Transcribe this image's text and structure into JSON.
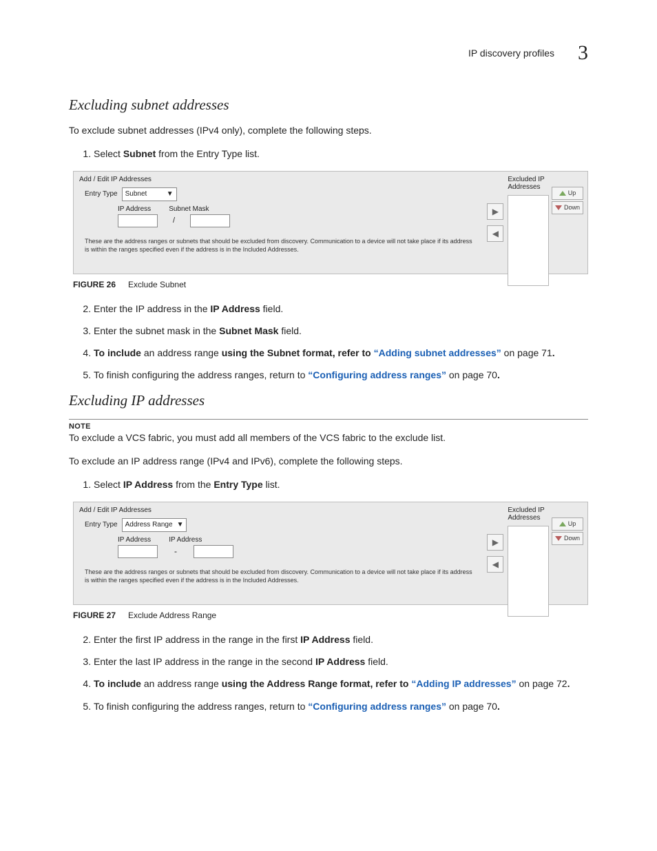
{
  "header": {
    "title": "IP discovery profiles",
    "chapter": "3"
  },
  "sec1": {
    "heading": "Excluding subnet addresses",
    "intro": "To exclude subnet addresses (IPv4 only), complete the following steps.",
    "step1_a": "Select ",
    "step1_b": "Subnet",
    "step1_c": " from the Entry Type list.",
    "fig": {
      "num": "FIGURE 26",
      "caption": "Exclude Subnet"
    },
    "step2_a": "Enter the IP address in the ",
    "step2_b": "IP Address",
    "step2_c": " field.",
    "step3_a": "Enter the subnet mask in the ",
    "step3_b": "Subnet Mask",
    "step3_c": " field.",
    "step4_a": "To include ",
    "step4_b": "an address range ",
    "step4_c": "using the Subnet format, refer to ",
    "step4_link": "“Adding subnet addresses”",
    "step4_d": " on page 71",
    "step4_e": ".",
    "step5_a": "To finish configuring the address ranges, return to ",
    "step5_link": "“Configuring address ranges”",
    "step5_b": " on page 70",
    "step5_c": "."
  },
  "sec2": {
    "heading": "Excluding IP addresses",
    "note_label": "NOTE",
    "note_text": "To exclude a VCS fabric, you must add all members of the VCS fabric to the exclude list.",
    "intro": "To exclude an IP address range (IPv4 and IPv6), complete the following steps.",
    "step1_a": "Select ",
    "step1_b": "IP Address",
    "step1_c": " from the ",
    "step1_d": "Entry Type",
    "step1_e": " list.",
    "fig": {
      "num": "FIGURE 27",
      "caption": "Exclude Address Range"
    },
    "step2_a": "Enter the first IP address in the range in the first ",
    "step2_b": "IP Address",
    "step2_c": " field.",
    "step3_a": "Enter the last IP address in the range in the second ",
    "step3_b": "IP Address",
    "step3_c": " field.",
    "step4_a": "To include ",
    "step4_b": "an address range ",
    "step4_c": "using the Address Range format, refer to ",
    "step4_link": "“Adding IP addresses”",
    "step4_d": " on page 72",
    "step4_e": ".",
    "step5_a": "To finish configuring the address ranges, return to ",
    "step5_link": "“Configuring address ranges”",
    "step5_b": " on page 70",
    "step5_c": "."
  },
  "dlg": {
    "left_title": "Add / Edit IP Addresses",
    "right_title": "Excluded IP Addresses",
    "entry_type": "Entry Type",
    "subnet": "Subnet",
    "address_range": "Address Range",
    "ip_address": "IP Address",
    "subnet_mask": "Subnet Mask",
    "help": "These are the address ranges or subnets that should be excluded from discovery. Communication to a device will not take place if its address is within the ranges specified even if the address is in the Included Addresses.",
    "up": "Up",
    "down": "Down"
  }
}
